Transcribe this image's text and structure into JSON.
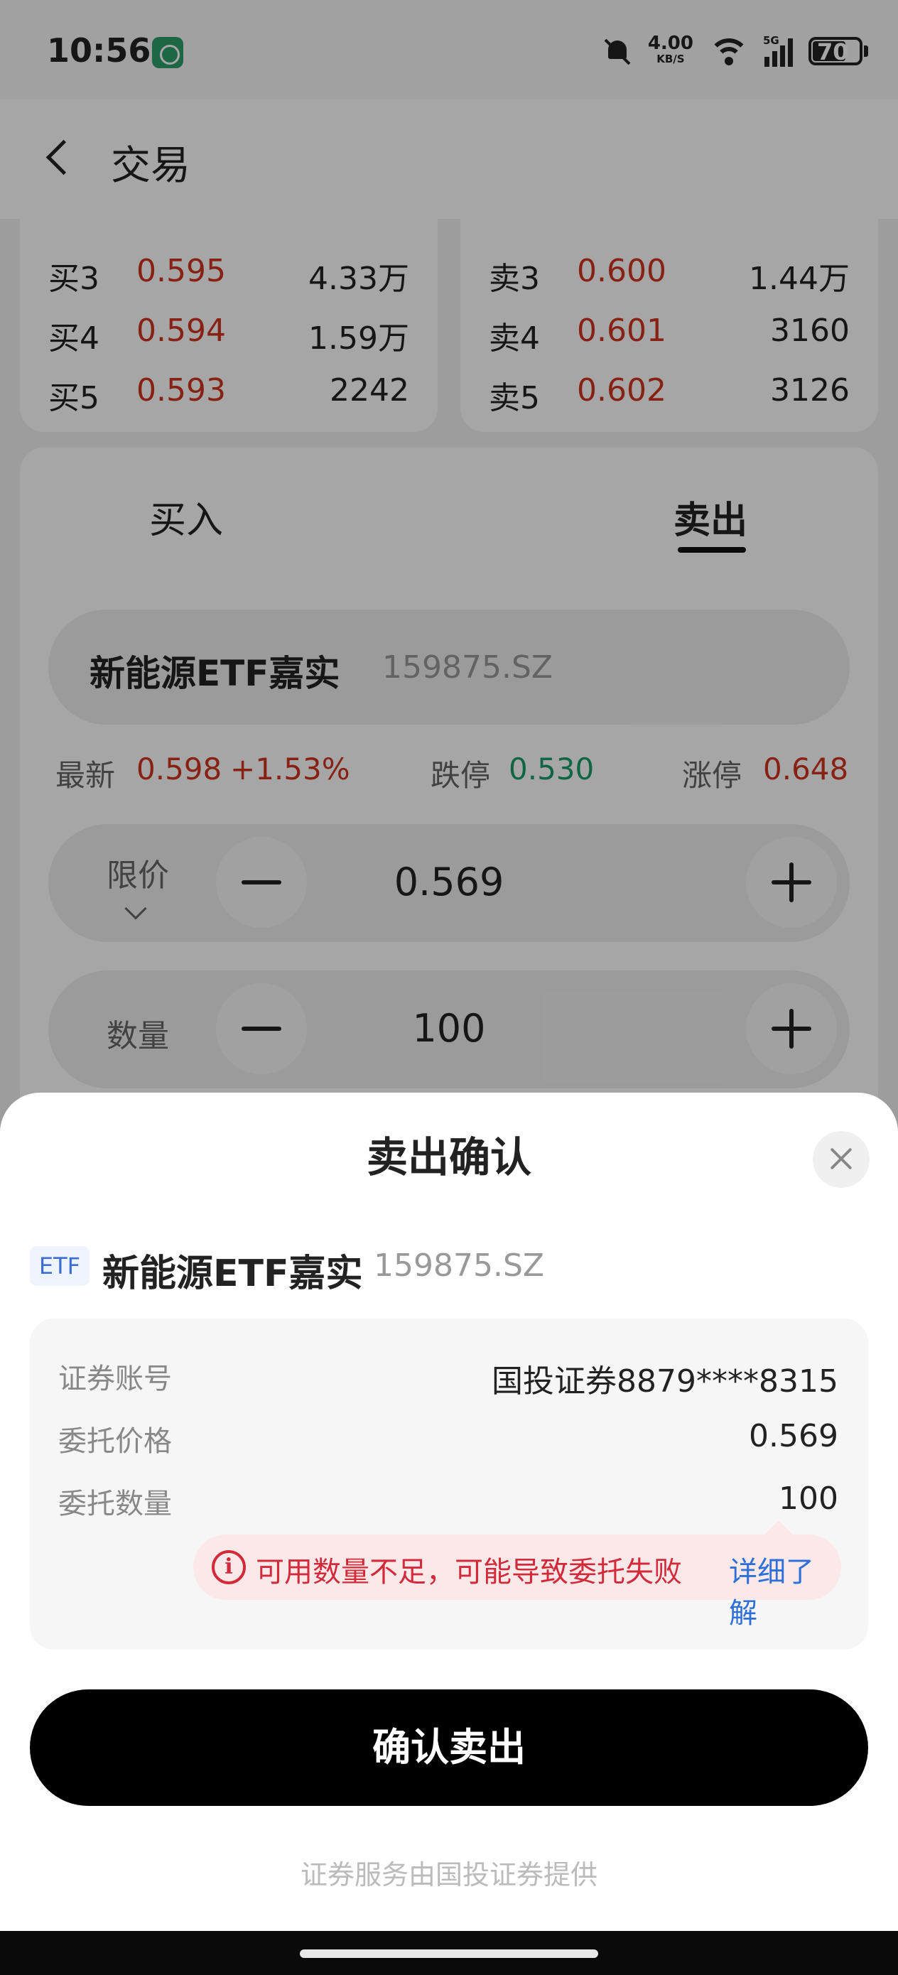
{
  "status_bar": {
    "time": "10:56",
    "net_speed": "4.00",
    "net_unit": "KB/S",
    "network_type": "5G",
    "battery": "70",
    "signal_bars": 4
  },
  "header": {
    "title": "交易"
  },
  "order_book": {
    "bids": [
      {
        "label": "买3",
        "price": "0.595",
        "volume": "4.33万"
      },
      {
        "label": "买4",
        "price": "0.594",
        "volume": "1.59万"
      },
      {
        "label": "买5",
        "price": "0.593",
        "volume": "2242"
      }
    ],
    "asks": [
      {
        "label": "卖3",
        "price": "0.600",
        "volume": "1.44万"
      },
      {
        "label": "卖4",
        "price": "0.601",
        "volume": "3160"
      },
      {
        "label": "卖5",
        "price": "0.602",
        "volume": "3126"
      }
    ]
  },
  "trade": {
    "tab_buy": "买入",
    "tab_sell": "卖出",
    "stock_name": "新能源ETF嘉实",
    "stock_code": "159875.SZ",
    "latest_label": "最新",
    "latest_price": "0.598",
    "latest_change": "+1.53%",
    "limit_down_label": "跌停",
    "limit_down": "0.530",
    "limit_up_label": "涨停",
    "limit_up": "0.648",
    "price_type": "限价",
    "price_value": "0.569",
    "qty_label": "数量",
    "qty_value": "100"
  },
  "sheet": {
    "title": "卖出确认",
    "badge": "ETF",
    "stock_name": "新能源ETF嘉实",
    "stock_code": "159875.SZ",
    "account_label": "证券账号",
    "account_value": "国投证券8879****8315",
    "price_label": "委托价格",
    "price_value": "0.569",
    "qty_label": "委托数量",
    "qty_value": "100",
    "warning_text": "可用数量不足，可能导致委托失败",
    "warning_link": "详细了解",
    "confirm_label": "确认卖出",
    "footer": "证券服务由国投证券提供"
  },
  "colors": {
    "up_red": "#d0341f",
    "down_green": "#1a9b6a",
    "warning_red": "#d22a3a",
    "link_blue": "#2f6fd8",
    "primary_button": "#000000"
  }
}
